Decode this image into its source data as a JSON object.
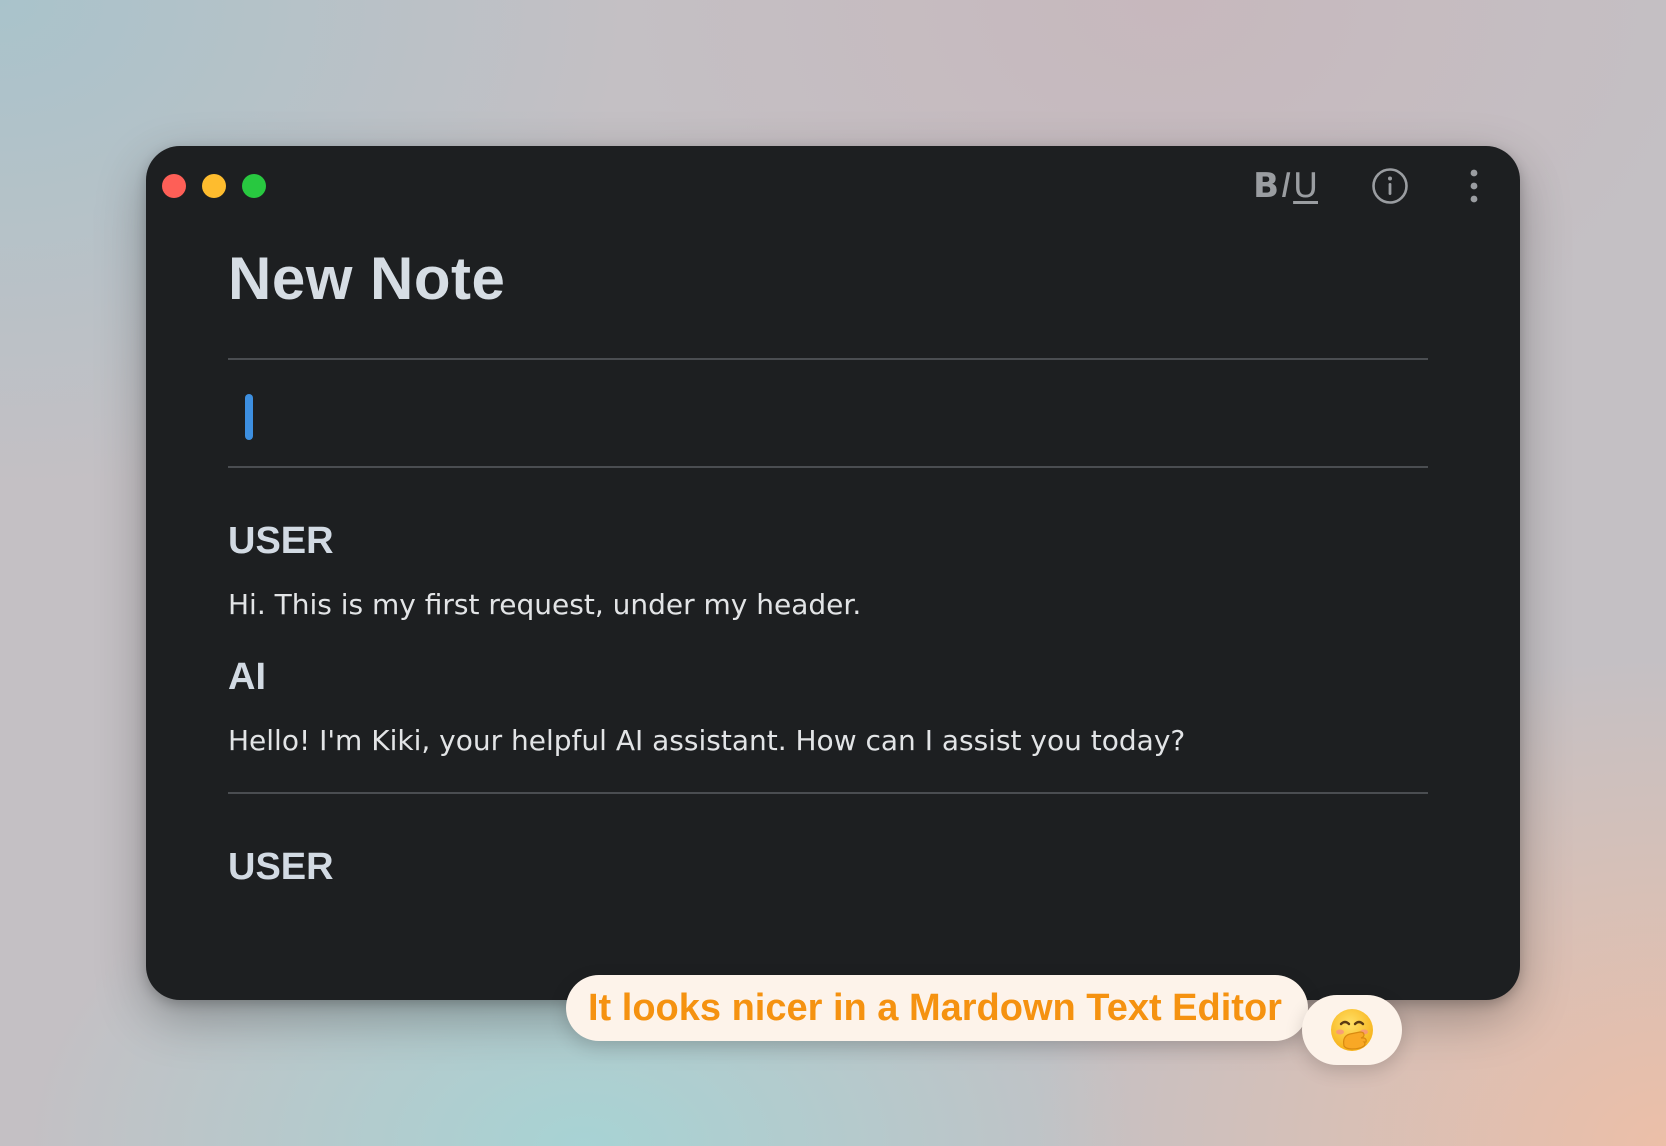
{
  "window": {
    "traffic_lights": [
      {
        "name": "close",
        "color": "#fe5f57"
      },
      {
        "name": "minimize",
        "color": "#febc2e"
      },
      {
        "name": "maximize",
        "color": "#28c840"
      }
    ],
    "toolbar": {
      "format_bold": "B",
      "format_italic": "I",
      "format_underline": "U",
      "info_icon": "info-circle-icon",
      "menu_icon": "more-vertical-icon"
    }
  },
  "note": {
    "title": "New Note",
    "messages": [
      {
        "role": "USER",
        "text": "Hi. This is my first request, under my header."
      },
      {
        "role": "AI",
        "text": "Hello! I'm Kiki, your helpful AI assistant. How can I assist you today?"
      }
    ],
    "pending_role": "USER"
  },
  "overlay": {
    "caption": "It looks nicer in a Mardown Text Editor",
    "emoji_icon": "face-with-hand-over-mouth-icon"
  },
  "colors": {
    "window_bg": "#1d1f21",
    "caret": "#3d8fe0",
    "caption": "#f59210",
    "caption_bg": "#fdf3ea"
  }
}
